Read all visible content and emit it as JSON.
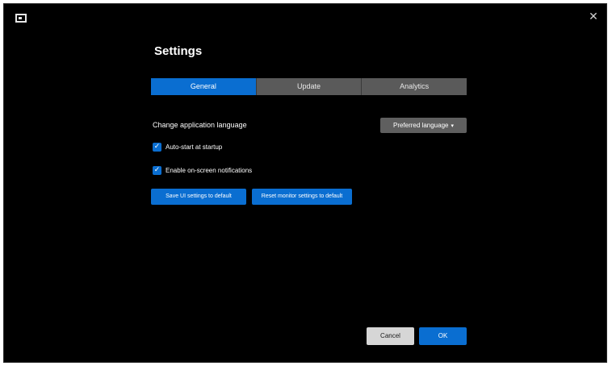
{
  "window": {
    "close_glyph": "✕",
    "app_icon": "monitor-icon"
  },
  "page": {
    "title": "Settings"
  },
  "tabs": [
    {
      "label": "General",
      "active": true
    },
    {
      "label": "Update",
      "active": false
    },
    {
      "label": "Analytics",
      "active": false
    }
  ],
  "language": {
    "label": "Change application language",
    "dropdown_value": "Preferred language",
    "dropdown_chevron": "▾"
  },
  "options": [
    {
      "label": "Auto-start at startup",
      "checked": true
    },
    {
      "label": "Enable on-screen notifications",
      "checked": true
    }
  ],
  "check_glyph": "✓",
  "actions": {
    "button_a": "Save UI settings to default",
    "button_b": "Reset monitor settings to default"
  },
  "footer": {
    "cancel_label": "Cancel",
    "ok_label": "OK"
  },
  "colors": {
    "accent": "#0a6ed1",
    "background": "#000000",
    "tab_inactive": "#5a5a5a",
    "cancel_bg": "#d6d6d6"
  }
}
